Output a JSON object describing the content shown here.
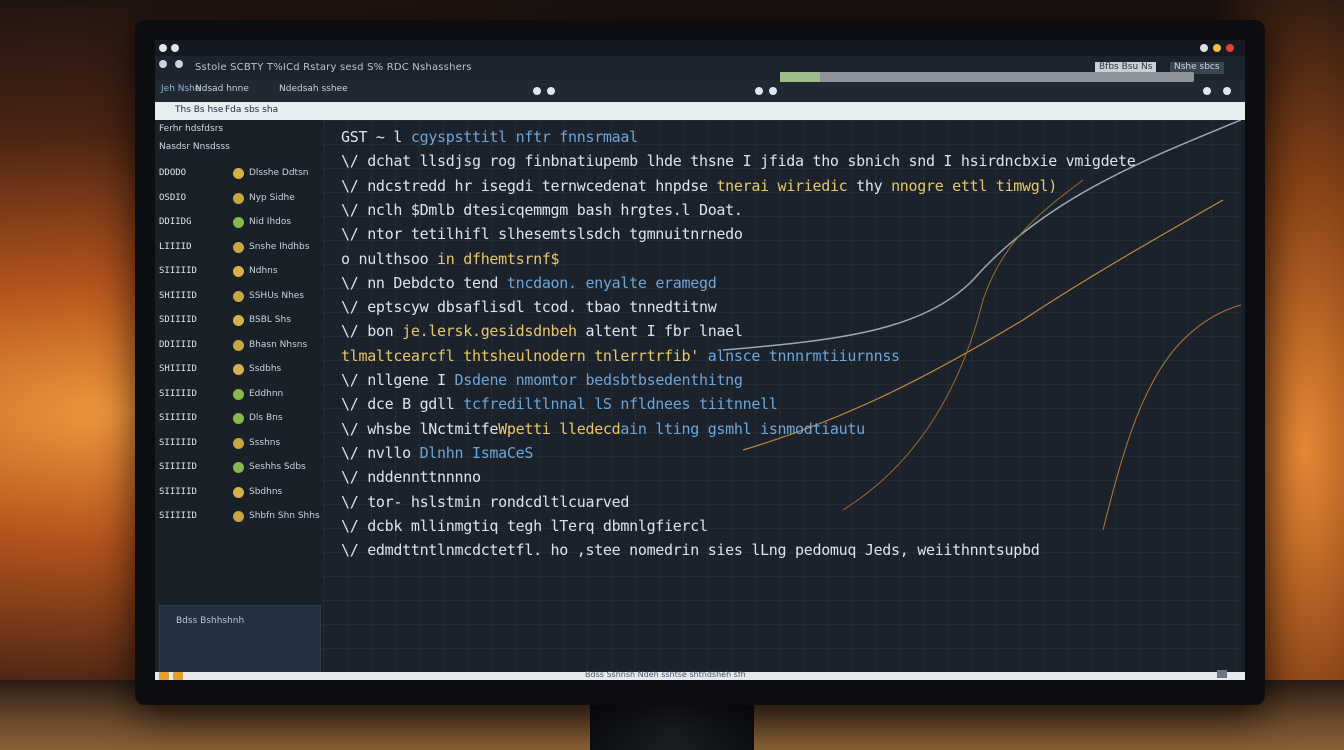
{
  "window": {
    "title_bar_controls": [
      "minimize",
      "maximize",
      "close"
    ],
    "control_colors": [
      "#e0e0e0",
      "#f0c040",
      "#e04040"
    ]
  },
  "menu": {
    "text": "Sstole SCBTY T%ICd Rstary sesd S% RDC Nshasshers",
    "right_field": "Bfbs Bsu Ns",
    "right_field2": "Nshe sbcs"
  },
  "toolbar": {
    "items": [
      "Jeh Nshe",
      "Ndsad hnne",
      "Ndedsah sshee"
    ]
  },
  "tabs": {
    "items": [
      "Ths Bs hse",
      "Fda sbs sha"
    ]
  },
  "sidebar": {
    "header1": "Ferhr hdsfdsrs",
    "header2": "Nasdsr Nnsdsss",
    "rows": [
      {
        "id": "DDODO",
        "name": "Dlsshe Ddtsn",
        "icon_color": "#d8b04a"
      },
      {
        "id": "OSDIO",
        "name": "Nyp Sidhe",
        "icon_color": "#c8a640"
      },
      {
        "id": "DDIIDG",
        "name": "Nid Ihdos",
        "icon_color": "#8ab84a"
      },
      {
        "id": "LIIIID",
        "name": "Snshe Ihdhbs",
        "icon_color": "#c8a640"
      },
      {
        "id": "SIIIIID",
        "name": "Ndhns",
        "icon_color": "#d8b04a"
      },
      {
        "id": "SHIIIID",
        "name": "SSHUs Nhes",
        "icon_color": "#c8a640"
      },
      {
        "id": "SDIIIID",
        "name": "BSBL Shs",
        "icon_color": "#d8b04a"
      },
      {
        "id": "DDIIIID",
        "name": "Bhasn Nhsns",
        "icon_color": "#c8a640"
      },
      {
        "id": "SHIIIID",
        "name": "Ssdbhs",
        "icon_color": "#d8b04a"
      },
      {
        "id": "SIIIIID",
        "name": "Eddhnn",
        "icon_color": "#8ab84a"
      },
      {
        "id": "SIIIIID",
        "name": "Dls Bns",
        "icon_color": "#8ab84a"
      },
      {
        "id": "SIIIIID",
        "name": "Ssshns",
        "icon_color": "#c8a640"
      },
      {
        "id": "SIIIIID",
        "name": "Seshhs Sdbs",
        "icon_color": "#8ab84a"
      },
      {
        "id": "SIIIIID",
        "name": "Sbdhns",
        "icon_color": "#d8b04a"
      },
      {
        "id": "SIIIIID",
        "name": "Shbfn Shn Shhs",
        "icon_color": "#c8a640"
      }
    ],
    "panel_text": "Bdss Bshhshnh"
  },
  "terminal": {
    "lines": [
      [
        {
          "t": "GST ~ l ",
          "c": "white"
        },
        {
          "t": "cgyspsttitl nftr fnnsrmaal",
          "c": "blue"
        }
      ],
      [
        {
          "t": "\\/ dchat llsdjsg rog finbnatiupemb lhde thsne I jfida tho sbnich snd I hsirdncbxie vmigdete",
          "c": "white"
        }
      ],
      [
        {
          "t": "\\/ ndcstredd hr isegdi ternwcedenat hnpdse ",
          "c": "white"
        },
        {
          "t": "tnerai wiriedic",
          "c": "yellow"
        },
        {
          "t": " thy ",
          "c": "white"
        },
        {
          "t": "nnogre ettl timwgl)",
          "c": "yellow"
        }
      ],
      [
        {
          "t": "\\/ nclh $Dmlb dtesicqemmgm bash  hrgtes.l Doat.",
          "c": "white"
        }
      ],
      [
        {
          "t": "\\/ ntor tetilhifl slhesemtslsdch tgmnuitnrnedo",
          "c": "white"
        }
      ],
      [
        {
          "t": "o nulthsoo ",
          "c": "white"
        },
        {
          "t": "in dfhemtsrnf$",
          "c": "yellow"
        }
      ],
      [
        {
          "t": "\\/ nn  Debdcto tend  ",
          "c": "white"
        },
        {
          "t": "tncdaon. enyalte eramegd",
          "c": "blue"
        }
      ],
      [
        {
          "t": "\\/ eptscyw dbsaflisdl tcod. tbao tnnedtitnw",
          "c": "white"
        }
      ],
      [
        {
          "t": "\\/ bon ",
          "c": "white"
        },
        {
          "t": "je.lersk.gesidsdnbeh",
          "c": "yellow"
        },
        {
          "t": " altent I fbr lnael",
          "c": "white"
        }
      ],
      [
        {
          "t": "tlmaltcearcfl thtsheulnodern tnlerrtrfib' ",
          "c": "yellow"
        },
        {
          "t": "alnsce tnnnrmtiiurnnss",
          "c": "blue"
        }
      ],
      [
        {
          "t": "\\/ nllgene I ",
          "c": "white"
        },
        {
          "t": "Dsdene nmomtor bedsbtbsedenthitng",
          "c": "blue"
        }
      ],
      [
        {
          "t": "\\/ dce  B gdll ",
          "c": "white"
        },
        {
          "t": "tcfrediltlnnal lS nfldnees tiitnnell",
          "c": "blue"
        }
      ],
      [
        {
          "t": "\\/ whsbe lNctmitfe",
          "c": "white"
        },
        {
          "t": "Wpetti lledecd",
          "c": "yellow"
        },
        {
          "t": "ain lting gsmhl isnmodtiautu",
          "c": "blue"
        }
      ],
      [
        {
          "t": "\\/ nvllo ",
          "c": "white"
        },
        {
          "t": "Dlnhn",
          "c": "blue"
        },
        {
          "t": " IsmaCeS",
          "c": "blue"
        }
      ],
      [
        {
          "t": "\\/ nddennttnnnno",
          "c": "white"
        }
      ],
      [
        {
          "t": "\\/ tor-  hslstmin  rondcdltlcuarved",
          "c": "white"
        }
      ],
      [
        {
          "t": "\\/ dcbk mllinmgtiq tegh lTerq dbmnlgfiercl",
          "c": "white"
        }
      ],
      [
        {
          "t": "\\/ edmdttntlnmcdctetfl. ho ,stee nomedrin sies lLng pedomuq Jeds,  weiithnntsupbd",
          "c": "white"
        }
      ]
    ]
  },
  "statusbar": {
    "text": "Bdss Sshnsh Ndeh sshtse shtndsheh sfh"
  }
}
